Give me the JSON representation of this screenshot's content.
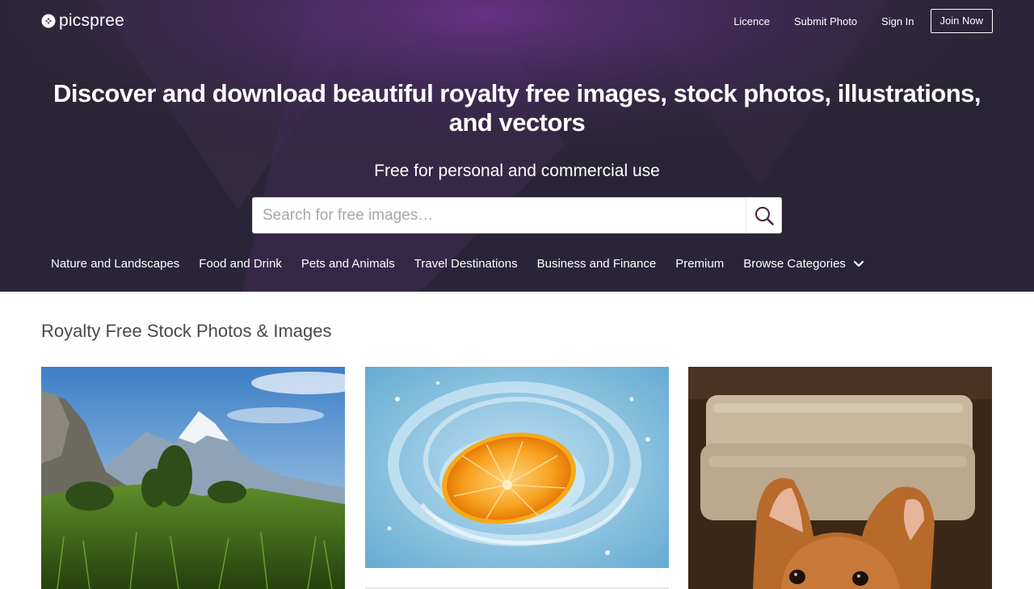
{
  "header": {
    "logo_text": "picspree",
    "nav": {
      "licence": "Licence",
      "submit_photo": "Submit Photo",
      "sign_in": "Sign In",
      "join_now": "Join Now"
    }
  },
  "hero": {
    "headline": "Discover and download beautiful royalty free images, stock photos, illustrations, and vectors",
    "subheadline": "Free for personal and commercial use",
    "search": {
      "placeholder": "Search for free images…",
      "value": "",
      "button_icon": "search-icon"
    },
    "categories": [
      "Nature and Landscapes",
      "Food and Drink",
      "Pets and Animals",
      "Travel Destinations",
      "Business and Finance",
      "Premium"
    ],
    "browse_label": "Browse Categories",
    "browse_icon": "chevron-down-icon"
  },
  "main": {
    "section_title": "Royalty Free Stock Photos & Images",
    "photos": [
      {
        "subject": "mountain-meadow-photo"
      },
      {
        "subject": "orange-splash-photo"
      },
      {
        "subject": "puppy-photo"
      }
    ]
  },
  "colors": {
    "hero_dark": "#2b2438",
    "hero_purple": "#5e2f7a",
    "search_icon": "#4a1f2e",
    "title_text": "#4a4a4a"
  }
}
